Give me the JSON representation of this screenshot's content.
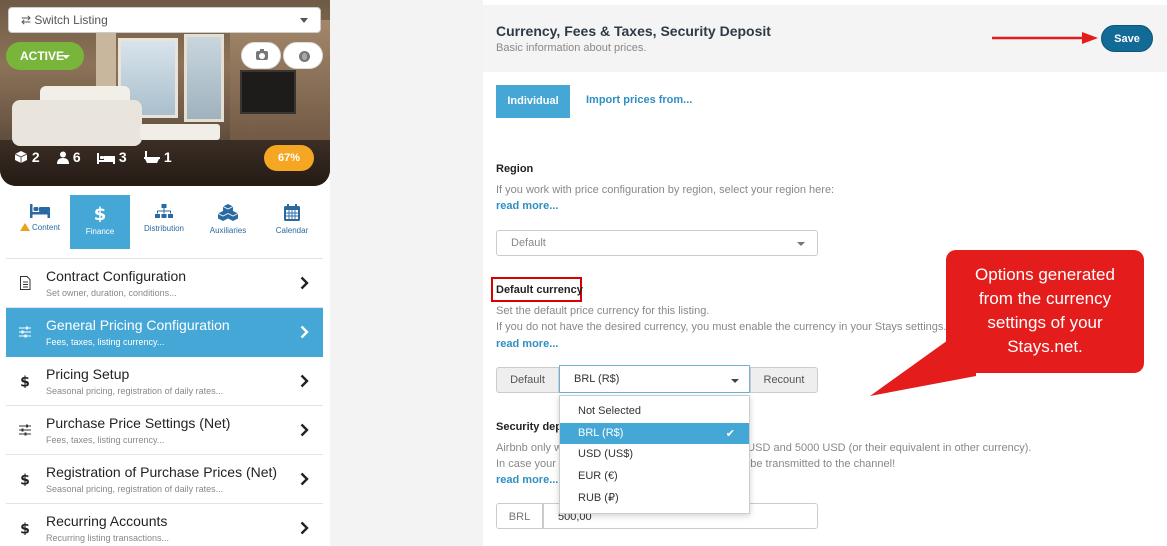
{
  "sidebar": {
    "switch_listing": "⇄ Switch Listing",
    "status": "ACTIVE",
    "stats": {
      "rooms": "2",
      "guests": "6",
      "beds": "3",
      "baths": "1"
    },
    "completion": "67%",
    "tabs": [
      {
        "label": "Content",
        "icon": "bed-icon",
        "warning": true
      },
      {
        "label": "Finance",
        "icon": "dollar-icon",
        "active": true
      },
      {
        "label": "Distribution",
        "icon": "sitemap-icon"
      },
      {
        "label": "Auxiliaries",
        "icon": "cubes-icon"
      },
      {
        "label": "Calendar",
        "icon": "calendar-icon"
      }
    ],
    "menu": [
      {
        "title": "Contract Configuration",
        "subtitle": "Set owner, duration, conditions...",
        "icon": "document-icon"
      },
      {
        "title": "General Pricing Configuration",
        "subtitle": "Fees, taxes, listing currency...",
        "icon": "sliders-icon",
        "active": true
      },
      {
        "title": "Pricing Setup",
        "subtitle": "Seasonal pricing, registration of daily rates...",
        "icon": "dollar-icon"
      },
      {
        "title": "Purchase Price Settings (Net)",
        "subtitle": "Fees, taxes, listing currency...",
        "icon": "sliders-icon"
      },
      {
        "title": "Registration of Purchase Prices (Net)",
        "subtitle": "Seasonal pricing, registration of daily rates...",
        "icon": "dollar-icon"
      },
      {
        "title": "Recurring Accounts",
        "subtitle": "Recurring listing transactions...",
        "icon": "dollar-icon"
      }
    ]
  },
  "main": {
    "title": "Currency, Fees & Taxes, Security Deposit",
    "subtitle": "Basic information about prices.",
    "save_label": "Save",
    "individual_label": "Individual",
    "import_label": "Import prices from...",
    "region": {
      "title": "Region",
      "help": "If you work with price configuration by region, select your region here:",
      "read_more": "read more...",
      "value": "Default"
    },
    "currency": {
      "title": "Default currency",
      "help1": "Set the default price currency for this listing.",
      "help2": "If you do not have the desired currency, you must enable the currency in your Stays settings.",
      "read_more": "read more...",
      "default_label": "Default",
      "selected": "BRL (R$)",
      "recount_label": "Recount",
      "options": [
        "Not Selected",
        "BRL (R$)",
        "USD (US$)",
        "EUR (€)",
        "RUB (₽)"
      ],
      "selected_index": 1
    },
    "deposit": {
      "title": "Security depo",
      "help1_left": "Airbnb only w",
      "help1_right": "0 USD and 5000 USD (or their equivalent in other currency).",
      "help2_left": "In case your a",
      "help2_right": "ot be transmitted to the channel!",
      "read_more": "read more...",
      "prefix": "BRL",
      "value": "500,00"
    }
  },
  "annotation": {
    "callout_lines": [
      "Options generated",
      "from the currency",
      "settings of your",
      "Stays.net."
    ],
    "color": "#e41c1c"
  },
  "colors": {
    "accent": "#45a7d6",
    "save": "#126a96",
    "active_status": "#79b53a",
    "completion": "#f5a623"
  }
}
